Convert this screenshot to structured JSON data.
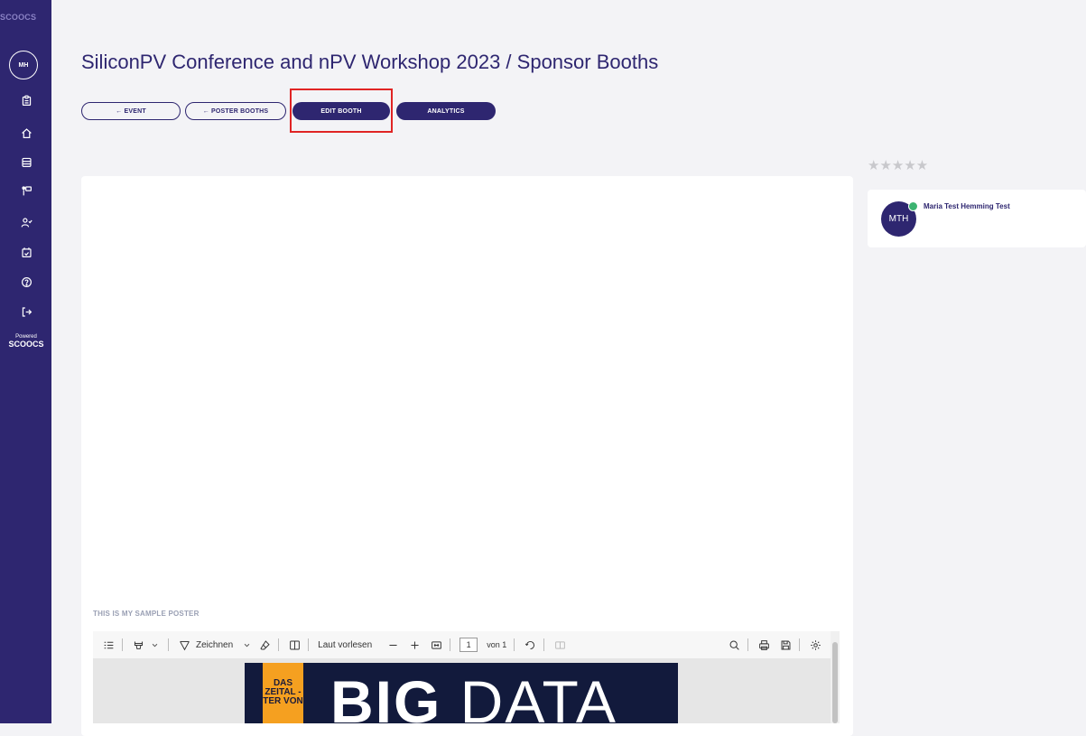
{
  "sidebar": {
    "logo_top": "SCOOCS",
    "avatar_initials": "MH",
    "icons": [
      "clipboard-icon",
      "home-icon",
      "store-icon",
      "presentation-icon",
      "users-icon",
      "calendar-check-icon",
      "help-icon",
      "logout-icon"
    ],
    "powered_label": "Powered",
    "powered_brand": "SCOOCS"
  },
  "header": {
    "title": "SiliconPV Conference and nPV Workshop 2023 / Sponsor Booths"
  },
  "buttons": {
    "event": "← EVENT",
    "poster_booths": "← POSTER BOOTHS",
    "edit_booth": "EDIT BOOTH",
    "analytics": "ANALYTICS"
  },
  "rating": {
    "stars": "★★★★★"
  },
  "poster": {
    "label": "THIS IS MY SAMPLE POSTER",
    "strip_text": "DAS ZEITAL -TER VON",
    "title_bold": "BIG",
    "title_light": " DATA"
  },
  "pdf_toolbar": {
    "draw_label": "Zeichnen",
    "read_aloud_label": "Laut vorlesen",
    "page_number": "1",
    "page_of": "von 1"
  },
  "user": {
    "initials": "MTH",
    "name": "Maria Test Hemming Test",
    "status_color": "#3cb371"
  },
  "colors": {
    "brand": "#2e2670",
    "highlight": "#e02424"
  }
}
